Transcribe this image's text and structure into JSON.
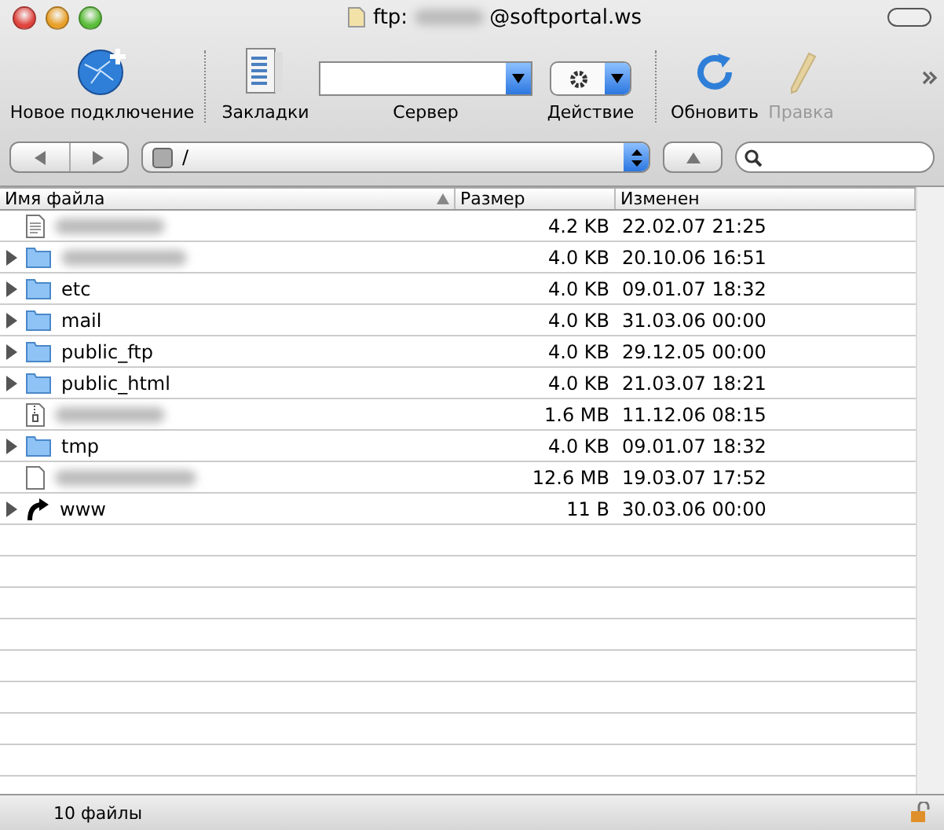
{
  "window": {
    "title_prefix": "ftp:",
    "title_suffix": "@softportal.ws"
  },
  "toolbar": {
    "items": [
      {
        "kind": "globe",
        "label": "Новое подключение",
        "disabled": false
      },
      {
        "kind": "bookmarks",
        "label": "Закладки",
        "disabled": false
      },
      {
        "kind": "combo",
        "label": "Сервер",
        "disabled": false
      },
      {
        "kind": "action",
        "label": "Действие",
        "disabled": false
      },
      {
        "kind": "refresh",
        "label": "Обновить",
        "disabled": false
      },
      {
        "kind": "edit",
        "label": "Правка",
        "disabled": true
      }
    ]
  },
  "path": {
    "value": "/"
  },
  "table": {
    "columns": [
      {
        "label": "Имя файла",
        "sorted": true
      },
      {
        "label": "Размер",
        "sorted": false
      },
      {
        "label": "Изменен",
        "sorted": false
      }
    ],
    "rows": [
      {
        "kind": "file",
        "expandable": false,
        "size": "4.2 KB",
        "modified": "22.02.07 21:25"
      },
      {
        "kind": "folder",
        "expandable": true,
        "size": "4.0 KB",
        "modified": "20.10.06 16:51"
      },
      {
        "kind": "folder",
        "expandable": true,
        "name": "etc",
        "size": "4.0 KB",
        "modified": "09.01.07 18:32"
      },
      {
        "kind": "folder",
        "expandable": true,
        "name": "mail",
        "size": "4.0 KB",
        "modified": "31.03.06 00:00"
      },
      {
        "kind": "folder",
        "expandable": true,
        "name": "public_ftp",
        "size": "4.0 KB",
        "modified": "29.12.05 00:00"
      },
      {
        "kind": "folder",
        "expandable": true,
        "name": "public_html",
        "size": "4.0 KB",
        "modified": "21.03.07 18:21"
      },
      {
        "kind": "archive",
        "expandable": false,
        "size": "1.6 MB",
        "modified": "11.12.06 08:15"
      },
      {
        "kind": "folder",
        "expandable": true,
        "name": "tmp",
        "size": "4.0 KB",
        "modified": "09.01.07 18:32"
      },
      {
        "kind": "blank",
        "expandable": false,
        "size": "12.6 MB",
        "modified": "19.03.07 17:52"
      },
      {
        "kind": "link",
        "expandable": true,
        "name": "www",
        "size": "11 B",
        "modified": "30.03.06 00:00"
      }
    ]
  },
  "status_bar": {
    "text": "10 файлы"
  }
}
